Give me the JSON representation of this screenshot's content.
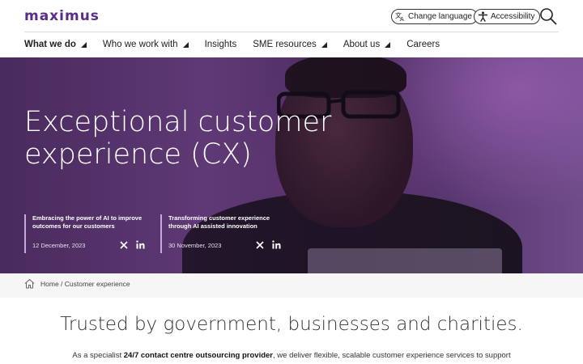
{
  "header": {
    "logo": "maximus",
    "change_language": "Change language",
    "accessibility": "Accessibility"
  },
  "nav": [
    {
      "label": "What we do",
      "has_dropdown": true,
      "active": true
    },
    {
      "label": "Who we work with",
      "has_dropdown": true
    },
    {
      "label": "Insights"
    },
    {
      "label": "SME resources",
      "has_dropdown": true
    },
    {
      "label": "About us",
      "has_dropdown": true
    },
    {
      "label": "Careers"
    }
  ],
  "hero": {
    "title_line1": "Exceptional customer",
    "title_line2": "experience (CX)",
    "cards": [
      {
        "title": "Embracing the power of AI to improve outcomes for our customers",
        "date": "12 December, 2023"
      },
      {
        "title": "Transforming customer experience through AI assisted innovation",
        "date": "30 November, 2023"
      }
    ]
  },
  "breadcrumb": {
    "home": "Home",
    "separator": " / ",
    "current": "Customer experience"
  },
  "intro": {
    "title": "Trusted by government, businesses and charities.",
    "text_before": "As a specialist ",
    "text_bold": "24/7 contact centre outsourcing provider",
    "text_after": ", we deliver flexible, scalable customer experience services to support"
  },
  "colors": {
    "brand": "#5a2c8c",
    "hero_overlay": "#6a4281",
    "card_accent": "#c7a8e0"
  },
  "icons": [
    "translate-icon",
    "accessibility-icon",
    "search-icon",
    "x-icon",
    "linkedin-icon",
    "home-icon"
  ]
}
